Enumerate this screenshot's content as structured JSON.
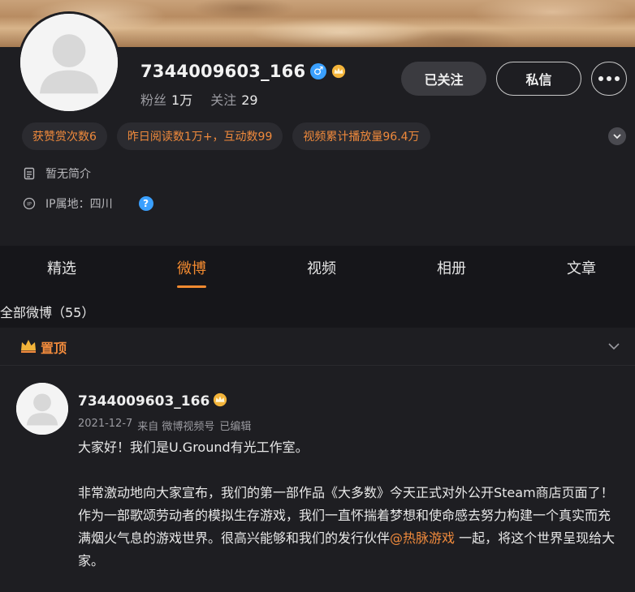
{
  "profile": {
    "username": "7344009603_166",
    "followers_label": "粉丝",
    "followers_value": "1万",
    "following_label": "关注",
    "following_value": "29",
    "followed_button": "已关注",
    "message_button": "私信",
    "tags": [
      "获赞赏次数6",
      "昨日阅读数1万+，互动数99",
      "视频累计播放量96.4万"
    ],
    "bio": "暂无简介",
    "ip": "IP属地：四川",
    "help_glyph": "?",
    "gender_glyph": "♂",
    "accent_color": "#f08a3c"
  },
  "tabs": [
    "精选",
    "微博",
    "视频",
    "相册",
    "文章"
  ],
  "active_tab": "微博",
  "section_title": "全部微博（55）",
  "post": {
    "pinned_label": "置顶",
    "author": "7344009603_166",
    "meta_date": "2021-12-7",
    "meta_source": "来自 微博视频号",
    "meta_edited": "已编辑",
    "line1": "大家好！我们是U.Ground有光工作室。",
    "line2_pre": "非常激动地向大家宣布，我们的第一部作品《大多数》今天正式对外公开Steam商店页面了！作为一部歌颂劳动者的模拟生存游戏，我们一直怀揣着梦想和使命感去努力构建一个真实而充满烟火气息的游戏世界。很高兴能够和我们的发行伙伴",
    "mention": "@热脉游戏",
    "line2_post": " 一起，将这个世界呈现给大家。"
  }
}
